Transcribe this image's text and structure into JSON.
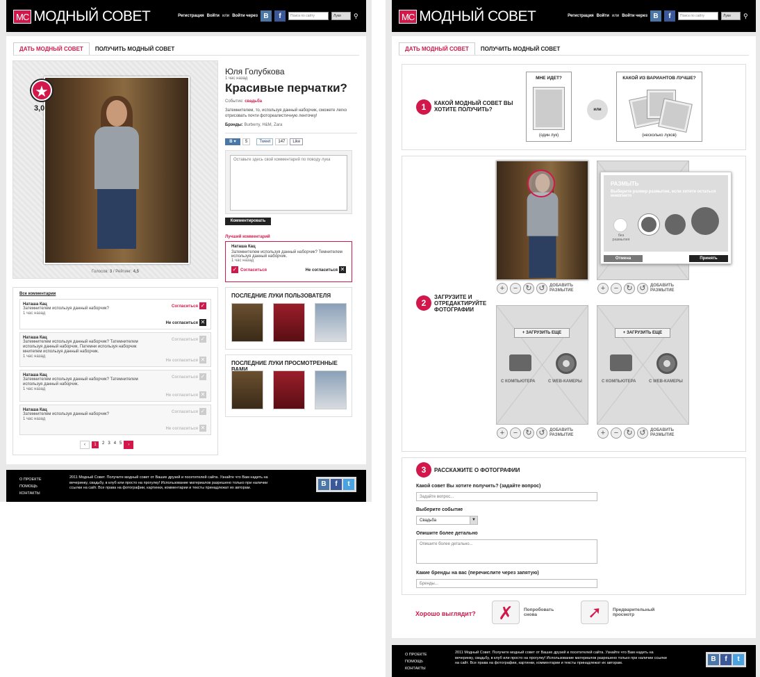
{
  "brand": {
    "logo_mark": "МС",
    "name": "МОДНЫЙ СОВЕТ"
  },
  "header": {
    "register": "Регистрация",
    "login": "Войти",
    "or": "или",
    "login_via": "Войти через",
    "search_placeholder": "Поиск по сайту",
    "search_scope": "Луки",
    "vk": "B",
    "fb": "f"
  },
  "tabs": {
    "give": "ДАТЬ МОДНЫЙ СОВЕТ",
    "get": "ПОЛУЧИТЬ МОДНЫЙ СОВЕТ"
  },
  "look": {
    "rating_value": "3,0",
    "votes_label": "Голосов:",
    "votes": "3",
    "rating_label": "Рейтинг:",
    "rating": "4,5",
    "author": "Юля Голубкова",
    "time": "1 час назад",
    "title": "Красивые перчатки?",
    "event_label": "Событие:",
    "event": "свадьба",
    "description": "Затемнителем, то, используя данный наборчик, сможете легко отрисовать почти фотореалистичную ленточку!",
    "brands_label": "Брэнды:",
    "brands": "Burberry, H&M, Zara",
    "vk_like": "B ♥",
    "vk_count": "5",
    "tweet": "Tweet",
    "tweet_count": "147",
    "fb_like": "Like",
    "comment_placeholder": "Оставьте здесь свой комментарий по поводу лука",
    "comment_button": "Комментировать",
    "best_comment_label": "Лучший комментарий",
    "best_comment": {
      "name": "Наташа Кац",
      "text": "Затемнителем используя данный наборчик? Темнителем используя данный наборчик.",
      "time": "1 час назад",
      "agree": "Согласиться",
      "disagree": "Не согласиться"
    }
  },
  "comments": {
    "all_label": "Все комментарии",
    "items": [
      {
        "name": "Наташа Кац",
        "text": "Затемнителем используя данный наборчик?",
        "time": "1 час назад",
        "agree": "Согласиться",
        "disagree": "Не согласиться"
      },
      {
        "name": "Наташа Кац",
        "text": "Затемнителем используя данный наборчик? Татемнителем используя данный наборчик. Патемни используя наборчик мнитепем используя данный наборчик.",
        "time": "1 час назад",
        "agree": "Согласиться",
        "disagree": "Не согласиться"
      },
      {
        "name": "Наташа Кац",
        "text": "Затемнителем используя данный наборчик? Татемнителем используя данный наборчик.",
        "time": "1 час назад",
        "agree": "Согласиться",
        "disagree": "Не согласиться"
      },
      {
        "name": "Наташа Кац",
        "text": "Затемнителем используя данный наборчик?",
        "time": "1 час назад",
        "agree": "Согласиться",
        "disagree": "Не согласиться"
      }
    ],
    "pages": [
      "1",
      "2",
      "3",
      "4",
      "5"
    ],
    "prev": "‹",
    "next": "›"
  },
  "sidebar": {
    "user_looks": "ПОСЛЕДНИЕ ЛУКИ ПОЛЬЗОВАТЕЛЯ",
    "viewed_looks": "ПОСЛЕДНИЕ ЛУКИ ПРОСМОТРЕННЫЕ ВАМИ"
  },
  "footer": {
    "links": [
      "О ПРОЕКТЕ",
      "ПОМОЩЬ",
      "КОНТАКТЫ"
    ],
    "text": "2011 Модный Совет. Получите модный совет от Ваших друзей и посетителей сайта. Узнайте что Вам надеть на вечеринку, свадьбу, в клуб или просто на прогулку! Использование материалов разрешено только при наличии ссылки на сайт. Все права на фотографии, картинки, комментарии и тексты принадлежат их авторам."
  },
  "upload": {
    "step1": {
      "num": "1",
      "title": "КАКОЙ МОДНЫЙ СОВЕТ ВЫ ХОТИТЕ ПОЛУЧИТЬ?",
      "opt1_title": "МНЕ ИДЕТ?",
      "opt1_sub": "(один лук)",
      "or": "или",
      "opt2_title": "КАКОЙ ИЗ ВАРИАНТОВ ЛУЧШЕ?",
      "opt2_sub": "(несколько луков)"
    },
    "step2": {
      "num": "2",
      "title": "ЗАГРУЗИТЕ И ОТРЕДАКТИРУЙТЕ ФОТОГРАФИИ",
      "add_blur": "ДОБАВИТЬ РАЗМЫТИЕ",
      "upload_more": "+ ЗАГРУЗИТЬ ЕЩЕ",
      "from_pc": "С КОМПЬЮТЕРА",
      "from_cam": "С WEB-КАМЕРЫ",
      "blur_popup": {
        "title": "РАЗМЫТЬ",
        "desc": "Выберите размер размытия, если хотите остаться инкогнито",
        "none": "без размытия",
        "cancel": "Отмена",
        "apply": "Принять"
      }
    },
    "step3": {
      "num": "3",
      "title": "РАССКАЖИТЕ О ФОТОГРАФИИ",
      "q_label": "Какой совет Вы хотите получить? (задайте вопрос)",
      "q_placeholder": "Задайте вопрос...",
      "event_label": "Выберите событие",
      "event_value": "Свадьба",
      "desc_label": "Опишите более детально",
      "desc_placeholder": "Опишите более детально...",
      "brands_label": "Какие бренды на вас (перечислите через запятую)",
      "brands_placeholder": "Бренды..."
    },
    "looks_good": "Хорошо выглядит?",
    "try_again": "Попробовать снова",
    "preview": "Предварительный просмотр"
  },
  "colors": {
    "accent": "#d2184a",
    "header_bg": "#000000",
    "vk": "#4a76a8",
    "fb": "#3b5998",
    "tw": "#4aa3df"
  }
}
